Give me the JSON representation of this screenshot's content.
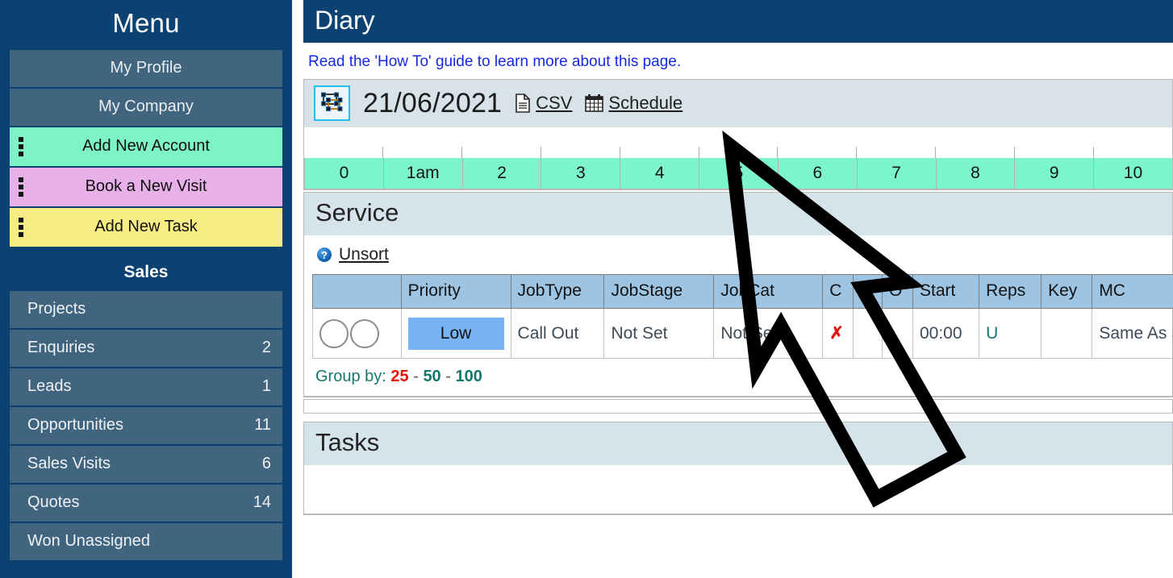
{
  "sidebar": {
    "title": "Menu",
    "plain_items": [
      {
        "label": "My Profile"
      },
      {
        "label": "My Company"
      }
    ],
    "action_items": [
      {
        "label": "Add New Account",
        "color": "#7df3c6",
        "icon": "vertical-dots-icon"
      },
      {
        "label": "Book a New Visit",
        "color": "#e7b0e8",
        "icon": "vertical-dots-icon"
      },
      {
        "label": "Add New Task",
        "color": "#f8ed84",
        "icon": "vertical-dots-icon"
      }
    ],
    "group_title": "Sales",
    "nav_items": [
      {
        "label": "Projects",
        "count": ""
      },
      {
        "label": "Enquiries",
        "count": "2"
      },
      {
        "label": "Leads",
        "count": "1"
      },
      {
        "label": "Opportunities",
        "count": "11"
      },
      {
        "label": "Sales Visits",
        "count": "6"
      },
      {
        "label": "Quotes",
        "count": "14"
      },
      {
        "label": "Won Unassigned",
        "count": ""
      }
    ],
    "bg_color": "#0b4271",
    "item_color": "#41657f"
  },
  "main": {
    "page_title": "Diary",
    "howto_text": "Read the 'How To' guide to learn more about this page.",
    "toolbar": {
      "date_value": "21/06/2021",
      "datepicker_icon": "select-transform-icon",
      "links": [
        {
          "label": "CSV",
          "icon": "document-icon"
        },
        {
          "label": "Schedule",
          "icon": "calendar-icon"
        }
      ]
    },
    "timeline": {
      "hours": [
        "0",
        "1am",
        "2",
        "3",
        "4",
        "5",
        "6",
        "7",
        "8",
        "9",
        "10"
      ],
      "band_color": "#7bf5c9"
    },
    "service_section": {
      "heading": "Service",
      "help_icon": "question-mark-icon",
      "unsort_label": "Unsort",
      "columns": [
        "",
        "Priority",
        "JobType",
        "JobStage",
        "JobCat",
        "C",
        "F",
        "O",
        "Start",
        "Reps",
        "Key",
        "MC"
      ],
      "rows": [
        {
          "selectors": "two-circles",
          "priority": "Low",
          "jobtype": "Call Out",
          "jobstage": "Not Set",
          "jobcat": "Not Set",
          "c": "✗",
          "f": "",
          "o": "",
          "start": "00:00",
          "reps": "U",
          "key": "",
          "mc": "Same As Site"
        }
      ],
      "groupby_label": "Group by:",
      "groupby_options": [
        "25",
        "50",
        "100"
      ],
      "groupby_separator": "-"
    },
    "tasks_section": {
      "heading": "Tasks"
    }
  },
  "cursor": {
    "name": "mouse-pointer-outline",
    "stroke_color": "#000000"
  }
}
